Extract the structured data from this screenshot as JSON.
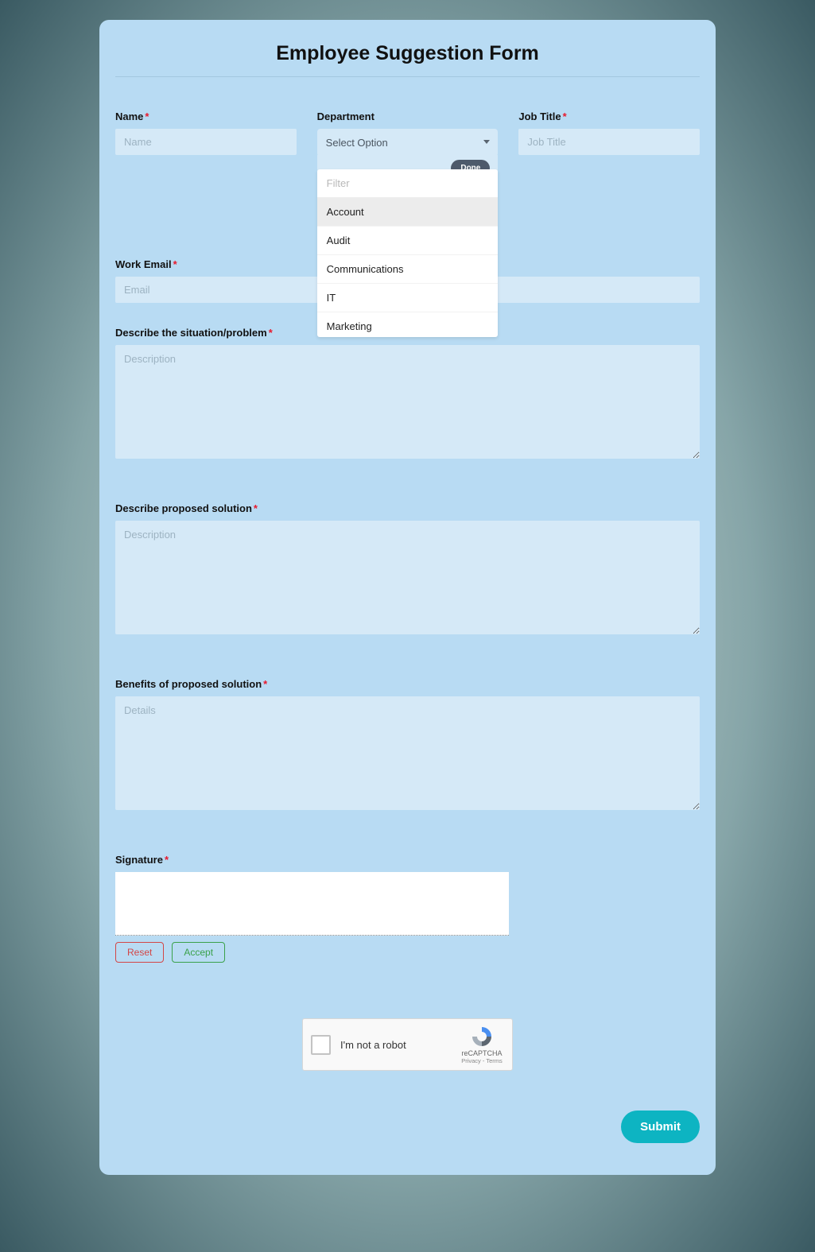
{
  "title": "Employee Suggestion Form",
  "required_mark": "*",
  "fields": {
    "name": {
      "label": "Name",
      "placeholder": "Name",
      "required": true
    },
    "department": {
      "label": "Department",
      "selected": "Select Option",
      "done_label": "Done",
      "filter_placeholder": "Filter",
      "options": [
        "Account",
        "Audit",
        "Communications",
        "IT",
        "Marketing"
      ]
    },
    "job_title": {
      "label": "Job Title",
      "placeholder": "Job Title",
      "required": true
    },
    "work_email": {
      "label": "Work Email",
      "placeholder": "Email",
      "required": true
    },
    "situation": {
      "label": "Describe the situation/problem",
      "placeholder": "Description",
      "required": true
    },
    "solution": {
      "label": "Describe proposed solution",
      "placeholder": "Description",
      "required": true
    },
    "benefits": {
      "label": "Benefits of proposed solution",
      "placeholder": "Details",
      "required": true
    },
    "signature": {
      "label": "Signature",
      "required": true
    }
  },
  "buttons": {
    "reset": "Reset",
    "accept": "Accept",
    "submit": "Submit"
  },
  "recaptcha": {
    "label": "I'm not a robot",
    "brand": "reCAPTCHA",
    "links": "Privacy - Terms"
  }
}
